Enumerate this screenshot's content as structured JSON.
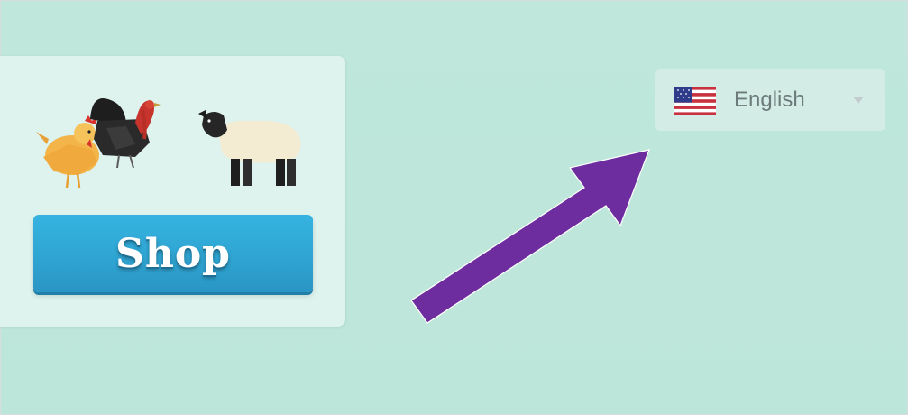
{
  "shop_card": {
    "button_label": "Shop",
    "animals": [
      "chicken-icon",
      "turkey-icon",
      "sheep-icon"
    ]
  },
  "language_selector": {
    "selected_label": "English",
    "flag": "us-flag-icon",
    "dropdown_icon": "chevron-down-icon"
  },
  "annotation": {
    "type": "arrow",
    "color": "#6e2d9e",
    "points_to": "language-selector"
  },
  "colors": {
    "background": "#bfe7dc",
    "card": "#def2ee",
    "button": "#2fa5d3",
    "selector": "#d3ede6"
  }
}
